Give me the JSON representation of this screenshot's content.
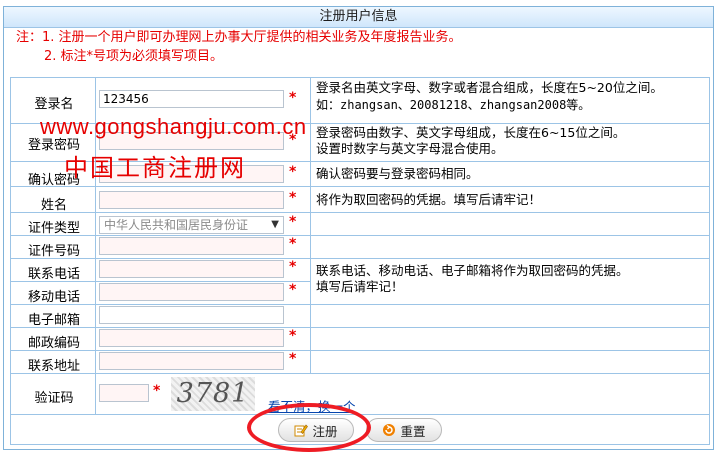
{
  "header": {
    "title": "注册用户信息"
  },
  "notice": {
    "line1": "注：1. 注册一个用户即可办理网上办事大厅提供的相关业务及年度报告业务。",
    "line2": "2. 标注*号项为必须填写项目。"
  },
  "required_mark": "*",
  "fields": {
    "login_name": {
      "label": "登录名",
      "value": "123456",
      "desc1": "登录名由英文字母、数字或者混合组成，长度在5~20位之间。",
      "desc2": "如：zhangsan、20081218、zhangsan2008等。"
    },
    "password": {
      "label": "登录密码",
      "desc1": "登录密码由数字、英文字母组成，长度在6~15位之间。",
      "desc2": "设置时数字与英文字母混合使用。"
    },
    "confirm_password": {
      "label": "确认密码",
      "desc": "确认密码要与登录密码相同。"
    },
    "name": {
      "label": "姓名",
      "desc": "将作为取回密码的凭据。填写后请牢记！"
    },
    "id_type": {
      "label": "证件类型",
      "selected": "中华人民共和国居民身份证"
    },
    "id_number": {
      "label": "证件号码"
    },
    "phone": {
      "label": "联系电话",
      "desc1": "联系电话、移动电话、电子邮箱将作为取回密码的凭据。",
      "desc2": "填写后请牢记！"
    },
    "mobile": {
      "label": "移动电话"
    },
    "email": {
      "label": "电子邮箱"
    },
    "postcode": {
      "label": "邮政编码"
    },
    "address": {
      "label": "联系地址"
    },
    "captcha": {
      "label": "验证码",
      "image_text": "3781",
      "refresh_link": "看不清，换一个"
    }
  },
  "watermark": {
    "url": "www.gongshangju.com.cn",
    "name": "中国工商注册网"
  },
  "buttons": {
    "register": "注册",
    "reset": "重置"
  },
  "colors": {
    "accent_red": "#e60000",
    "border_blue": "#9cc4e6",
    "highlight_ring": "#ee1c24"
  }
}
